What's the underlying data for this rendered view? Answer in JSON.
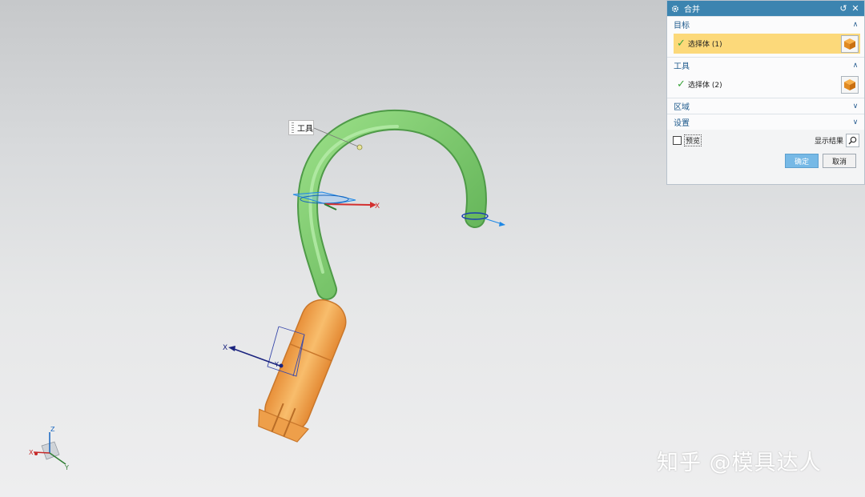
{
  "dialog": {
    "title": "合并",
    "icons": {
      "settings": "gear-icon",
      "reset": "reset-icon",
      "close": "close-icon"
    },
    "groups": {
      "target": {
        "header": "目标",
        "selection_label": "选择体 (1)",
        "chevron": "collapse"
      },
      "tool": {
        "header": "工具",
        "selection_label": "选择体 (2)",
        "chevron": "collapse"
      },
      "region": {
        "header": "区域",
        "chevron": "expand"
      },
      "settings": {
        "header": "设置",
        "chevron": "expand"
      }
    },
    "preview_label": "预览",
    "preview_checked": false,
    "show_result_label": "显示结果",
    "ok_label": "确定",
    "cancel_label": "取消"
  },
  "viewport": {
    "tool_label": "工具",
    "handle_axis_label_1": "X",
    "handle_axis_label_2": "X",
    "handle_axis_label_2b": "Y",
    "triad": {
      "x": "X",
      "y": "Y",
      "z": "Z"
    }
  },
  "watermark": "知乎 @模具达人",
  "colors": {
    "title_bar": "#3c84b0",
    "selected_row": "#fcd97a",
    "green_body": "#7ccb6c",
    "orange_body": "#f2a74f",
    "ok_button": "#76b9e6"
  }
}
